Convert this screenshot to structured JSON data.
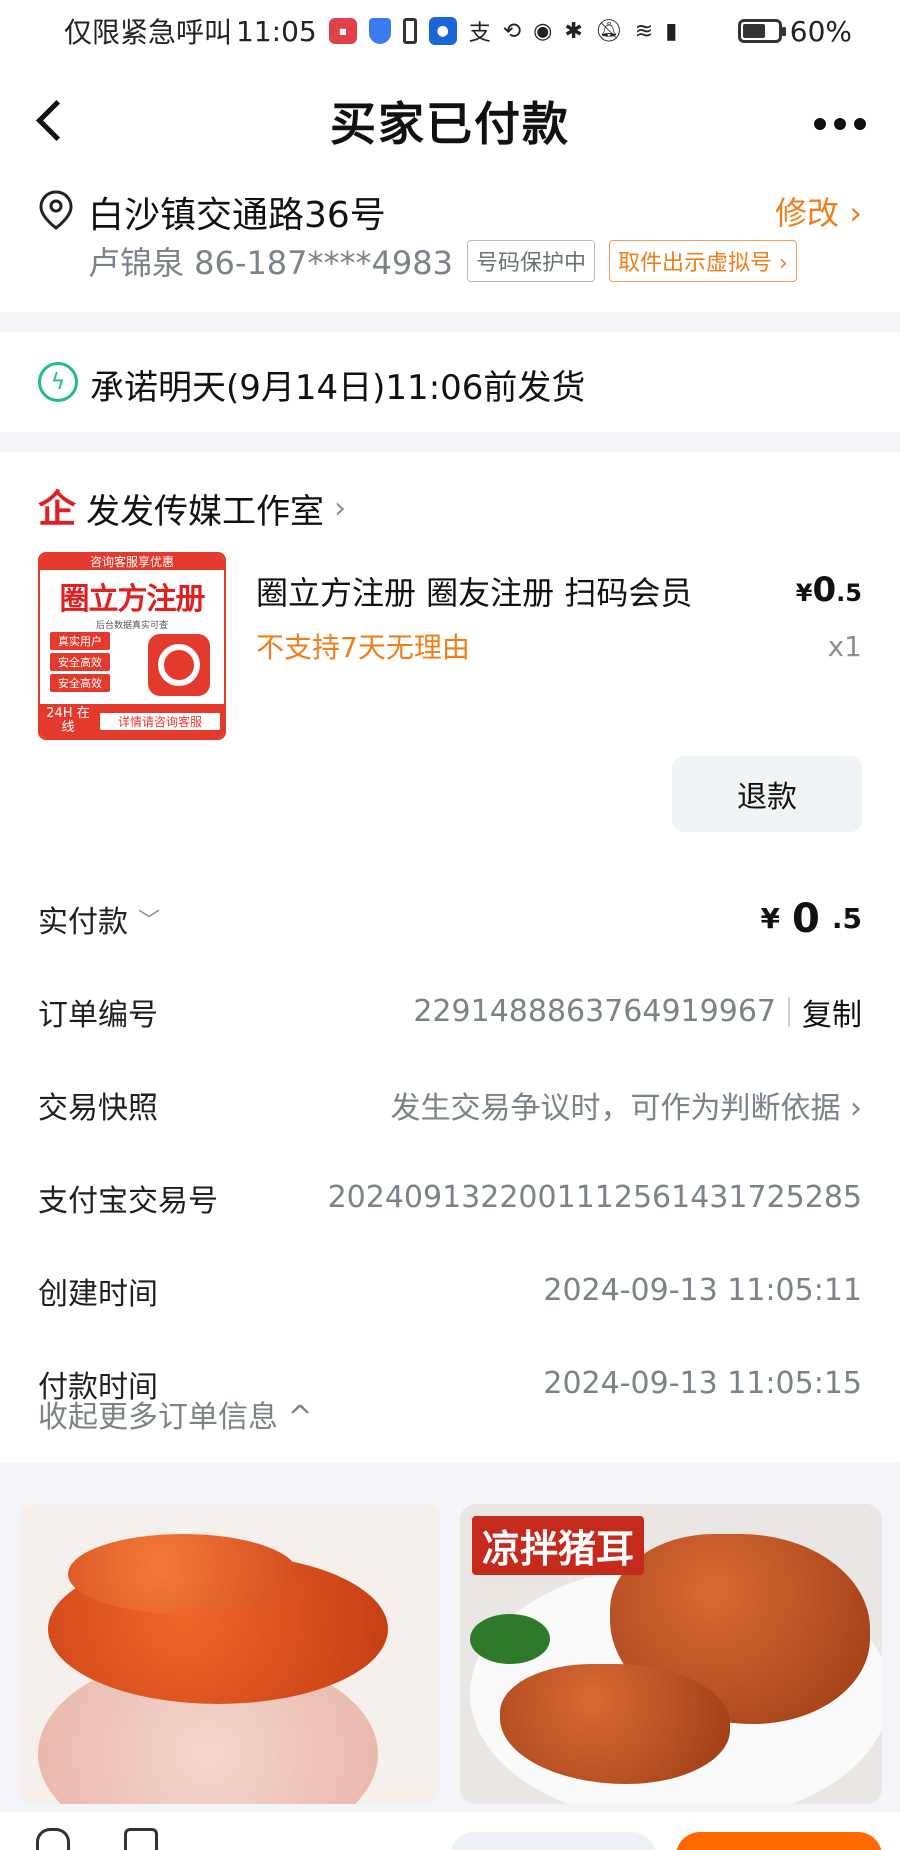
{
  "status_bar": {
    "carrier": "仅限紧急呼叫",
    "time": "11:05",
    "battery_percent": "60%",
    "battery_level": 0.6,
    "icons": [
      "app-icon",
      "shield-icon",
      "phone-icon",
      "assistant-icon",
      "alipay-icon",
      "sync-icon",
      "eye-icon",
      "bluetooth-icon",
      "mute-icon",
      "wifi-icon",
      "signal-icon",
      "battery-icon"
    ]
  },
  "nav": {
    "title": "买家已付款",
    "back_icon": "back-chevron-icon",
    "more_icon": "more-dots-icon"
  },
  "address": {
    "location": "白沙镇交通路36号",
    "edit_label": "修改 ›",
    "contact": "卢锦泉 86-187****4983",
    "tag_protect": "号码保护中",
    "tag_virtual": "取件出示虚拟号 ›"
  },
  "promise": {
    "text": "承诺明天(9月14日)11:06前发货"
  },
  "order": {
    "shop_name": "发发传媒工作室",
    "shop_chevron": "›",
    "product": {
      "thumb_top": "咨询客服享优惠",
      "thumb_title": "圈立方注册",
      "thumb_sub": "后台数据真实可查",
      "thumb_pills": [
        "真实用户",
        "安全高效",
        "安全高效"
      ],
      "thumb_badge": "24H 在线",
      "thumb_cta": "详情请咨询客服",
      "name": "圈立方注册 圈友注册 扫码会员",
      "note": "不支持7天无理由",
      "price_symbol": "¥",
      "price_int": "0",
      "price_dec": ".5",
      "quantity": "x1"
    },
    "refund_label": "退款",
    "rows": [
      {
        "label": "实付款",
        "value_symbol": "¥",
        "value_int": "0",
        "value_dec": ".5"
      },
      {
        "label": "订单编号",
        "value": "2291488863764919967",
        "action": "复制"
      },
      {
        "label": "交易快照",
        "value": "发生交易争议时，可作为判断依据 ›"
      },
      {
        "label": "支付宝交易号",
        "value": "2024091322001112561431725285"
      },
      {
        "label": "创建时间",
        "value": "2024-09-13 11:05:11"
      },
      {
        "label": "付款时间",
        "value": "2024-09-13 11:05:15"
      }
    ],
    "collapse_label": "收起更多订单信息 ^"
  },
  "recommendations": [
    {
      "title": ""
    },
    {
      "title": "凉拌猪耳"
    }
  ],
  "colors": {
    "accent_orange": "#f07e1b",
    "brand_red": "#e02020",
    "promise_green": "#1fbf83",
    "page_bg": "#f3f5f9"
  }
}
